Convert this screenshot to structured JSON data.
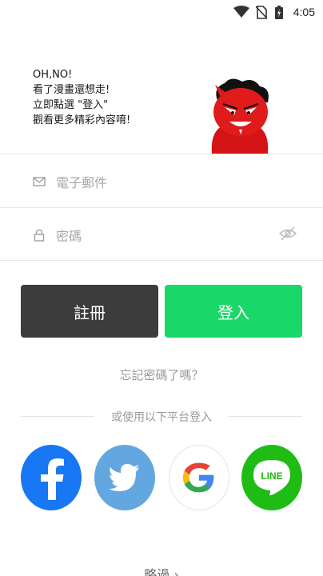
{
  "status_bar": {
    "time": "4:05"
  },
  "hero": {
    "lines": [
      "OH,NO!",
      "看了漫畫還想走!",
      "立即點選 \"登入\"",
      "觀看更多精彩內容唷!"
    ]
  },
  "form": {
    "email_placeholder": "電子郵件",
    "password_placeholder": "密碼"
  },
  "buttons": {
    "register": "註冊",
    "login": "登入"
  },
  "forgot_password": "忘記密碼了嗎？",
  "social_prompt": "或使用以下平台登入",
  "social": [
    "facebook",
    "twitter",
    "google",
    "line"
  ],
  "social_line_text": "LINE",
  "skip": "略過 ›",
  "colors": {
    "register_bg": "#3c3c3c",
    "login_bg": "#1ad76a",
    "facebook": "#1877f2",
    "twitter": "#63a7e0",
    "line": "#1fbc15"
  }
}
